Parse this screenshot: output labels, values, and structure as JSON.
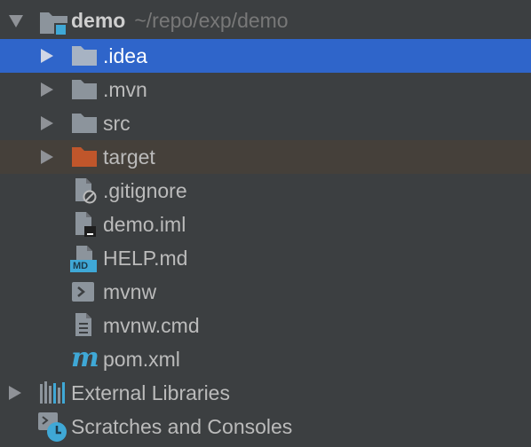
{
  "project": {
    "name": "demo",
    "path": "~/repo/exp/demo"
  },
  "items": [
    {
      "label": ".idea",
      "kind": "folder",
      "expandable": true,
      "state": "selected"
    },
    {
      "label": ".mvn",
      "kind": "folder",
      "expandable": true,
      "state": "normal"
    },
    {
      "label": "src",
      "kind": "folder",
      "expandable": true,
      "state": "normal"
    },
    {
      "label": "target",
      "kind": "folder-excluded",
      "expandable": true,
      "state": "excluded"
    },
    {
      "label": ".gitignore",
      "kind": "file-ignore",
      "expandable": false,
      "state": "normal"
    },
    {
      "label": "demo.iml",
      "kind": "file-iml",
      "expandable": false,
      "state": "normal"
    },
    {
      "label": "HELP.md",
      "kind": "file-markdown",
      "expandable": false,
      "state": "normal"
    },
    {
      "label": "mvnw",
      "kind": "file-shell",
      "expandable": false,
      "state": "normal"
    },
    {
      "label": "mvnw.cmd",
      "kind": "file-text",
      "expandable": false,
      "state": "normal"
    },
    {
      "label": "pom.xml",
      "kind": "file-maven",
      "expandable": false,
      "state": "normal"
    }
  ],
  "external_libraries": {
    "label": "External Libraries"
  },
  "scratches": {
    "label": "Scratches and Consoles"
  },
  "icon_badge_text": "MD",
  "maven_glyph": "m",
  "colors": {
    "selection": "#2f65ca",
    "excluded_row": "#45403a",
    "folder": "#8c949c",
    "excluded_folder": "#c0562b",
    "module_badge": "#3fa8d6",
    "text": "#bbbbbb",
    "path_text": "#787878"
  }
}
